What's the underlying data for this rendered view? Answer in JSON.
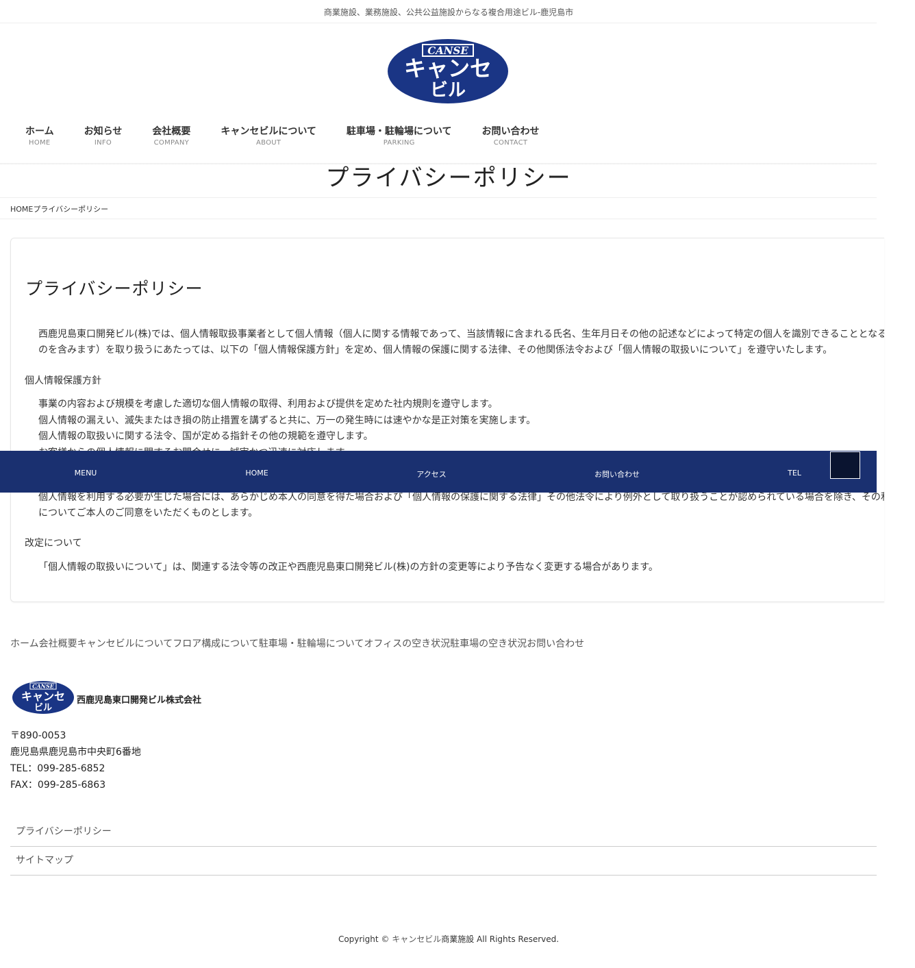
{
  "header": {
    "tagline": "商業施設、業務施設、公共公益施設からなる複合用途ビル-鹿児島市",
    "logo": {
      "top_text": "CANSE",
      "main_text": "キャンセ",
      "sub_text": "ビル",
      "color": "#1a3585"
    }
  },
  "nav": {
    "items": [
      {
        "ja": "ホーム",
        "en": "HOME"
      },
      {
        "ja": "お知らせ",
        "en": "INFO"
      },
      {
        "ja": "会社概要",
        "en": "COMPANY"
      },
      {
        "ja": "キャンセビルについて",
        "en": "ABOUT"
      },
      {
        "ja": "駐車場・駐輪場について",
        "en": "PARKING"
      },
      {
        "ja": "お問い合わせ",
        "en": "CONTACT"
      }
    ]
  },
  "page": {
    "title": "プライバシーポリシー",
    "breadcrumb": {
      "home": "HOME",
      "current": "プライバシーポリシー"
    }
  },
  "content": {
    "heading": "プライバシーポリシー",
    "intro_line1": "西鹿児島東口開発ビル(株)では、個人情報取扱事業者として個人情報（個人に関する情報であって、当該情報に含まれる氏名、生年月日その他の記述などによって特定の個人を識別できることとなるも",
    "intro_line2": "のを含みます）を取り扱うにあたっては、以下の「個人情報保護方針」を定め、個人情報の保護に関する法律、その他関係法令および「個人情報の取扱いについて」を遵守いたします。",
    "policy_heading": "個人情報保護方針",
    "policy_items": [
      "事業の内容および規模を考慮した適切な個人情報の取得、利用および提供を定めた社内規則を遵守します。",
      "個人情報の漏えい、滅失またはき損の防止措置を講ずると共に、万一の発生時には速やかな是正対策を実施します。",
      "個人情報の取扱いに関する法令、国が定める指針その他の規範を遵守します。",
      "お客様からの個人情報に関するお問合せに、誠実かつ迅速に対応します。"
    ],
    "usage_line1": "個人情報を利用する必要が生じた場合には、あらかじめ本人の同意を得た場合および「個人情報の保護に関する法律」その他法令により例外として取り扱うことが認められている場合を除き、その利用目的",
    "usage_line2": "についてご本人のご同意をいただくものとします。",
    "revision_heading": "改定について",
    "revision_text": "「個人情報の取扱いについて」は、関連する法令等の改正や西鹿児島東口開発ビル(株)の方針の変更等により予告なく変更する場合があります。"
  },
  "fixed_bar": {
    "items": [
      "MENU",
      "HOME",
      "アクセス",
      "お問い合わせ",
      "TEL"
    ],
    "color": "#1a3070"
  },
  "footer": {
    "links": [
      "ホーム",
      "会社概要",
      "キャンセビルについて",
      "フロア構成について",
      "駐車場・駐輪場について",
      "オフィスの空き状況",
      "駐車場の空き状況",
      "お問い合わせ"
    ],
    "company_name": "西鹿児島東口開発ビル株式会社",
    "postal": "〒890-0053",
    "address": "鹿児島県鹿児島市中央町6番地",
    "tel": "TEL：099-285-6852",
    "fax": "FAX：099-285-6863",
    "list": [
      "プライバシーポリシー",
      "サイトマップ"
    ],
    "copyright_prefix": "Copyright © ",
    "copyright_brand": "キャンセビル",
    "copyright_suffix": "商業施設 All Rights Reserved."
  }
}
